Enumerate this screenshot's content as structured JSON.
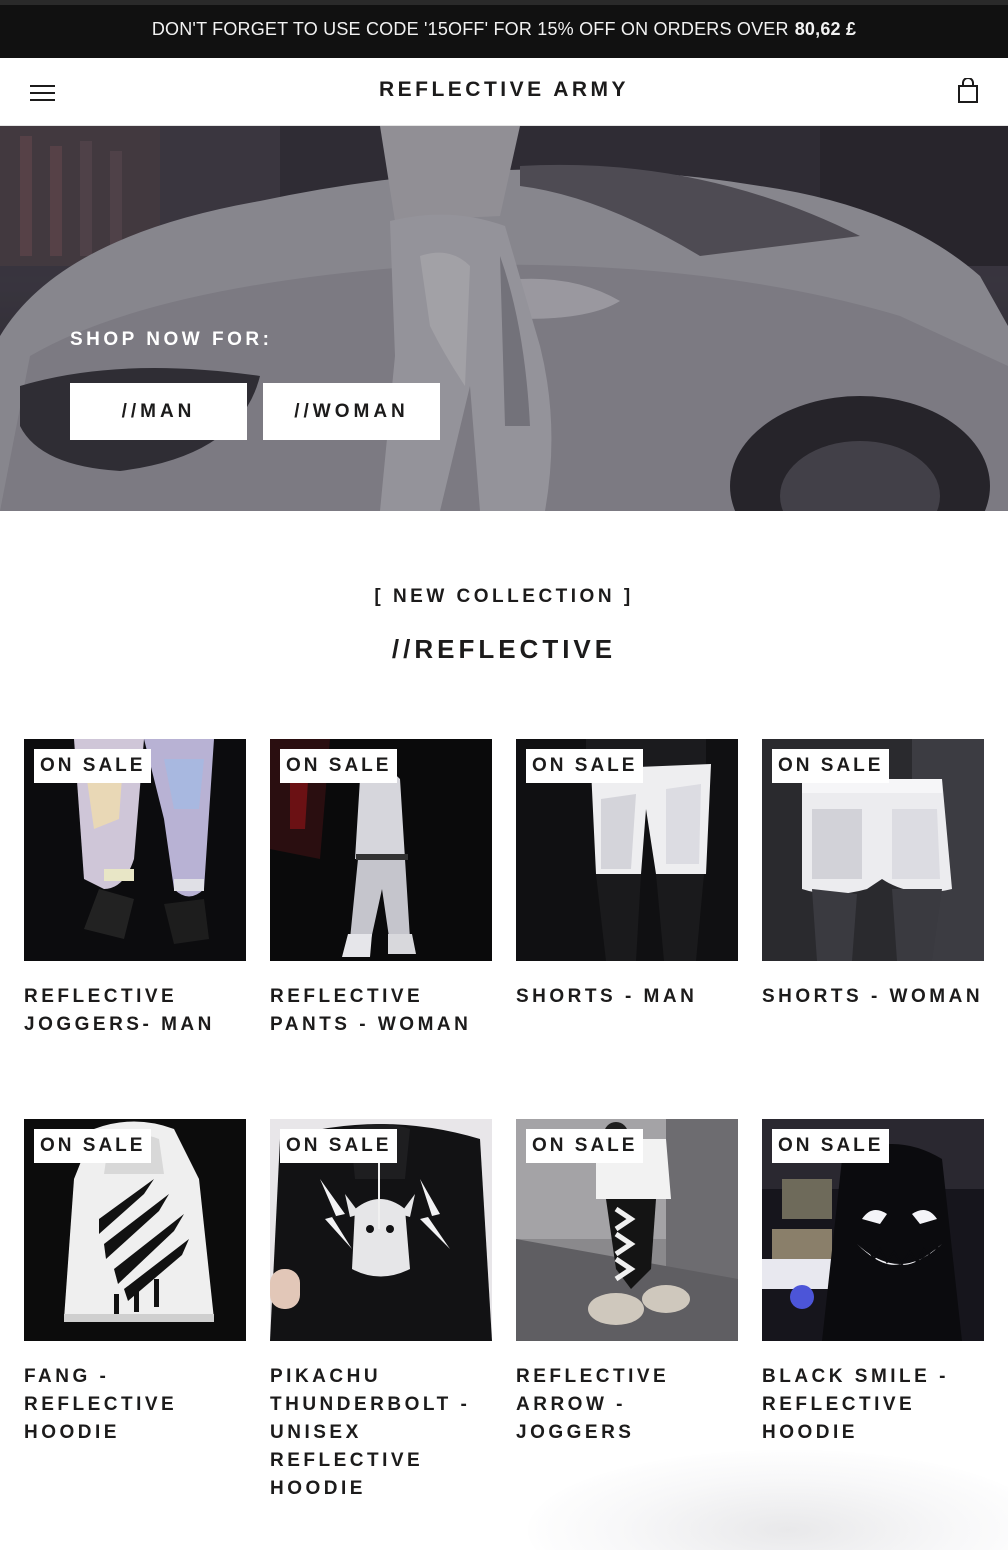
{
  "announcement": {
    "text": "DON'T FORGET TO USE CODE '15OFF' FOR 15% OFF ON ORDERS OVER",
    "amount": "80,62 £"
  },
  "header": {
    "logo": "REFLECTIVE ARMY",
    "menu_icon": "hamburger-menu-icon",
    "cart_icon": "shopping-bag-icon"
  },
  "hero": {
    "label": "SHOP NOW FOR:",
    "buttons": [
      {
        "label": "//MAN"
      },
      {
        "label": "//WOMAN"
      }
    ]
  },
  "collection": {
    "subtitle": "[ NEW COLLECTION ]",
    "title": "//REFLECTIVE"
  },
  "products": [
    {
      "badge": "ON SALE",
      "title": "REFLECTIVE JOGGERS- MAN"
    },
    {
      "badge": "ON SALE",
      "title": "REFLECTIVE PANTS - WOMAN"
    },
    {
      "badge": "ON SALE",
      "title": "SHORTS - MAN"
    },
    {
      "badge": "ON SALE",
      "title": "SHORTS - WOMAN"
    },
    {
      "badge": "ON SALE",
      "title": "FANG - REFLECTIVE HOODIE"
    },
    {
      "badge": "ON SALE",
      "title": "PIKACHU THUNDERBOLT - UNISEX REFLECTIVE HOODIE"
    },
    {
      "badge": "ON SALE",
      "title": "REFLECTIVE ARROW - JOGGERS"
    },
    {
      "badge": "ON SALE",
      "title": "BLACK SMILE - REFLECTIVE HOODIE"
    }
  ]
}
